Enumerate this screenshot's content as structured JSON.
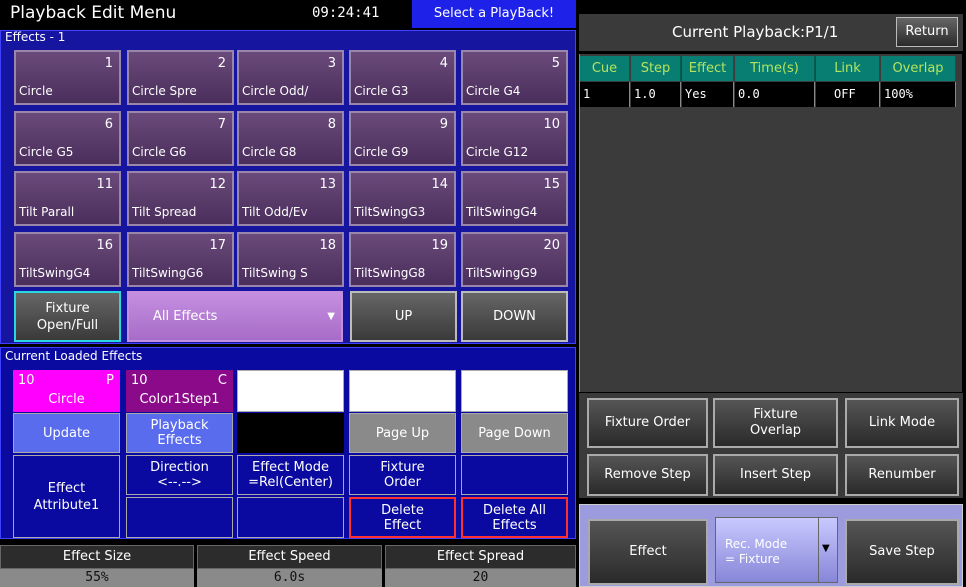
{
  "header": {
    "title": "Playback Edit Menu",
    "time": "09:24:41",
    "select_prompt": "Select a PlayBack!"
  },
  "effects": {
    "label": "Effects - 1",
    "buttons": [
      {
        "num": "1",
        "name": "Circle"
      },
      {
        "num": "2",
        "name": "Circle Spre"
      },
      {
        "num": "3",
        "name": "Circle Odd/"
      },
      {
        "num": "4",
        "name": "Circle G3"
      },
      {
        "num": "5",
        "name": "Circle G4"
      },
      {
        "num": "6",
        "name": "Circle G5"
      },
      {
        "num": "7",
        "name": "Circle G6"
      },
      {
        "num": "8",
        "name": "Circle G8"
      },
      {
        "num": "9",
        "name": "Circle G9"
      },
      {
        "num": "10",
        "name": "Circle G12"
      },
      {
        "num": "11",
        "name": "Tilt Parall"
      },
      {
        "num": "12",
        "name": "Tilt Spread"
      },
      {
        "num": "13",
        "name": "Tilt Odd/Ev"
      },
      {
        "num": "14",
        "name": "TiltSwingG3"
      },
      {
        "num": "15",
        "name": "TiltSwingG4"
      },
      {
        "num": "16",
        "name": "TiltSwingG4"
      },
      {
        "num": "17",
        "name": "TiltSwingG6"
      },
      {
        "num": "18",
        "name": "TiltSwing S"
      },
      {
        "num": "19",
        "name": "TiltSwingG8"
      },
      {
        "num": "20",
        "name": "TiltSwingG9"
      }
    ],
    "fixture_line1": "Fixture",
    "fixture_line2": "Open/Full",
    "all_effects": "All Effects",
    "up": "UP",
    "down": "DOWN"
  },
  "loaded": {
    "label": "Current Loaded Effects",
    "slot1": {
      "num": "10",
      "tag": "P",
      "name": "Circle"
    },
    "slot2": {
      "num": "10",
      "tag": "C",
      "name": "Color1Step1"
    },
    "update": "Update",
    "playback_line1": "Playback",
    "playback_line2": "Effects",
    "page_up": "Page Up",
    "page_down": "Page Down",
    "attr_line1": "Effect",
    "attr_line2": "Attribute1",
    "dir_line1": "Direction",
    "dir_line2": "<--.-->",
    "mode_line1": "Effect Mode",
    "mode_line2": "=Rel(Center)",
    "fo_line1": "Fixture",
    "fo_line2": "Order",
    "del_line1": "Delete",
    "del_line2": "Effect",
    "delall_line1": "Delete All",
    "delall_line2": "Effects"
  },
  "params": [
    {
      "label": "Effect Size",
      "value": "55%"
    },
    {
      "label": "Effect Speed",
      "value": "6.0s"
    },
    {
      "label": "Effect Spread",
      "value": "20"
    }
  ],
  "right": {
    "title": "Current Playback:P1/1",
    "return": "Return",
    "columns": [
      "Cue",
      "Step",
      "Effect",
      "Time(s)",
      "Link",
      "Overlap"
    ],
    "row": [
      "1",
      "1.0",
      "Yes",
      "0.0",
      "OFF",
      "100%"
    ],
    "fixture_order": "Fixture Order",
    "fixture_overlap_1": "Fixture",
    "fixture_overlap_2": "Overlap",
    "link_mode": "Link Mode",
    "remove_step": "Remove Step",
    "insert_step": "Insert Step",
    "renumber": "Renumber",
    "effect": "Effect",
    "rec_mode_1": "Rec. Mode",
    "rec_mode_2": "= Fixture",
    "save_step": "Save Step"
  },
  "colors": {
    "accent_blue": "#1e22e8",
    "effect_pink": "#ff00ff",
    "effect_purple": "#8a0a8a",
    "header_teal": "#087e72"
  }
}
